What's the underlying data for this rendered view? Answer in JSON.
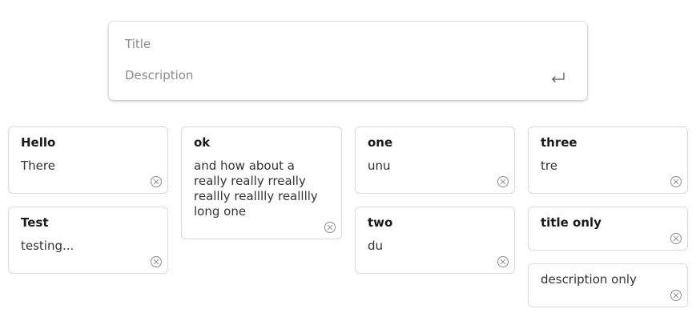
{
  "composer": {
    "title_placeholder": "Title",
    "description_placeholder": "Description",
    "submit_icon": "enter-return-icon"
  },
  "notes": [
    {
      "title": "Hello",
      "description": "There"
    },
    {
      "title": "Test",
      "description": "testing..."
    },
    {
      "title": "ok",
      "description": "and how about a really really rreally reallly realllly realllly long one"
    },
    {
      "title": "one",
      "description": "unu"
    },
    {
      "title": "two",
      "description": "du"
    },
    {
      "title": "three",
      "description": "tre"
    },
    {
      "title": "title only",
      "description": ""
    },
    {
      "title": "",
      "description": "description only"
    }
  ],
  "delete_icon": "circle-x-icon",
  "colors": {
    "card_border": "#d9d9d9",
    "icon": "#8a8a8a",
    "placeholder": "#8a8a8a"
  }
}
